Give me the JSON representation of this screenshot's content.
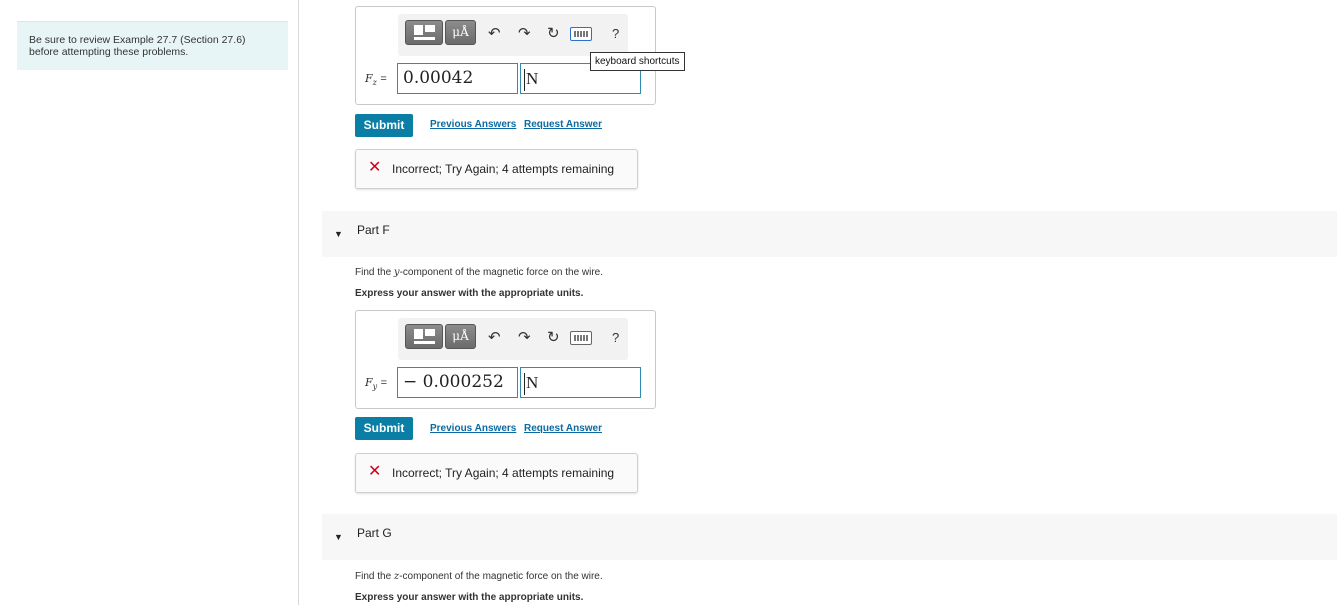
{
  "sidebar": {
    "hint_line1": "Be sure to review Example 27.7 (Section 27.6)",
    "hint_line2": "before attempting these problems."
  },
  "toolbar": {
    "units_label": "μÅ",
    "keyboard_tooltip": "keyboard shortcuts",
    "help_label": "?"
  },
  "part_e": {
    "var_symbol": "F",
    "var_sub": "z",
    "equals": "=",
    "value": "0.00042",
    "unit": "N",
    "submit_label": "Submit",
    "previous_answers": "Previous Answers",
    "request_answer": "Request Answer",
    "feedback": "Incorrect; Try Again; 4 attempts remaining"
  },
  "part_f": {
    "title": "Part F",
    "question_pre": "Find the ",
    "question_var": "y",
    "question_post": "-component of the magnetic force on the wire.",
    "instruction": "Express your answer with the appropriate units.",
    "var_symbol": "F",
    "var_sub": "y",
    "equals": "=",
    "value": "− 0.000252",
    "unit": "N",
    "submit_label": "Submit",
    "previous_answers": "Previous Answers",
    "request_answer": "Request Answer",
    "feedback": "Incorrect; Try Again; 4 attempts remaining"
  },
  "part_g": {
    "title": "Part G",
    "question_pre": "Find the ",
    "question_var": "z",
    "question_post": "-component of the magnetic force on the wire.",
    "instruction": "Express your answer with the appropriate units."
  },
  "colors": {
    "submit_bg": "#0a7ea4",
    "link": "#0a6aa1",
    "error": "#d0021b",
    "field_border": "#2f8bb4",
    "hint_bg": "#e8f5f7"
  }
}
